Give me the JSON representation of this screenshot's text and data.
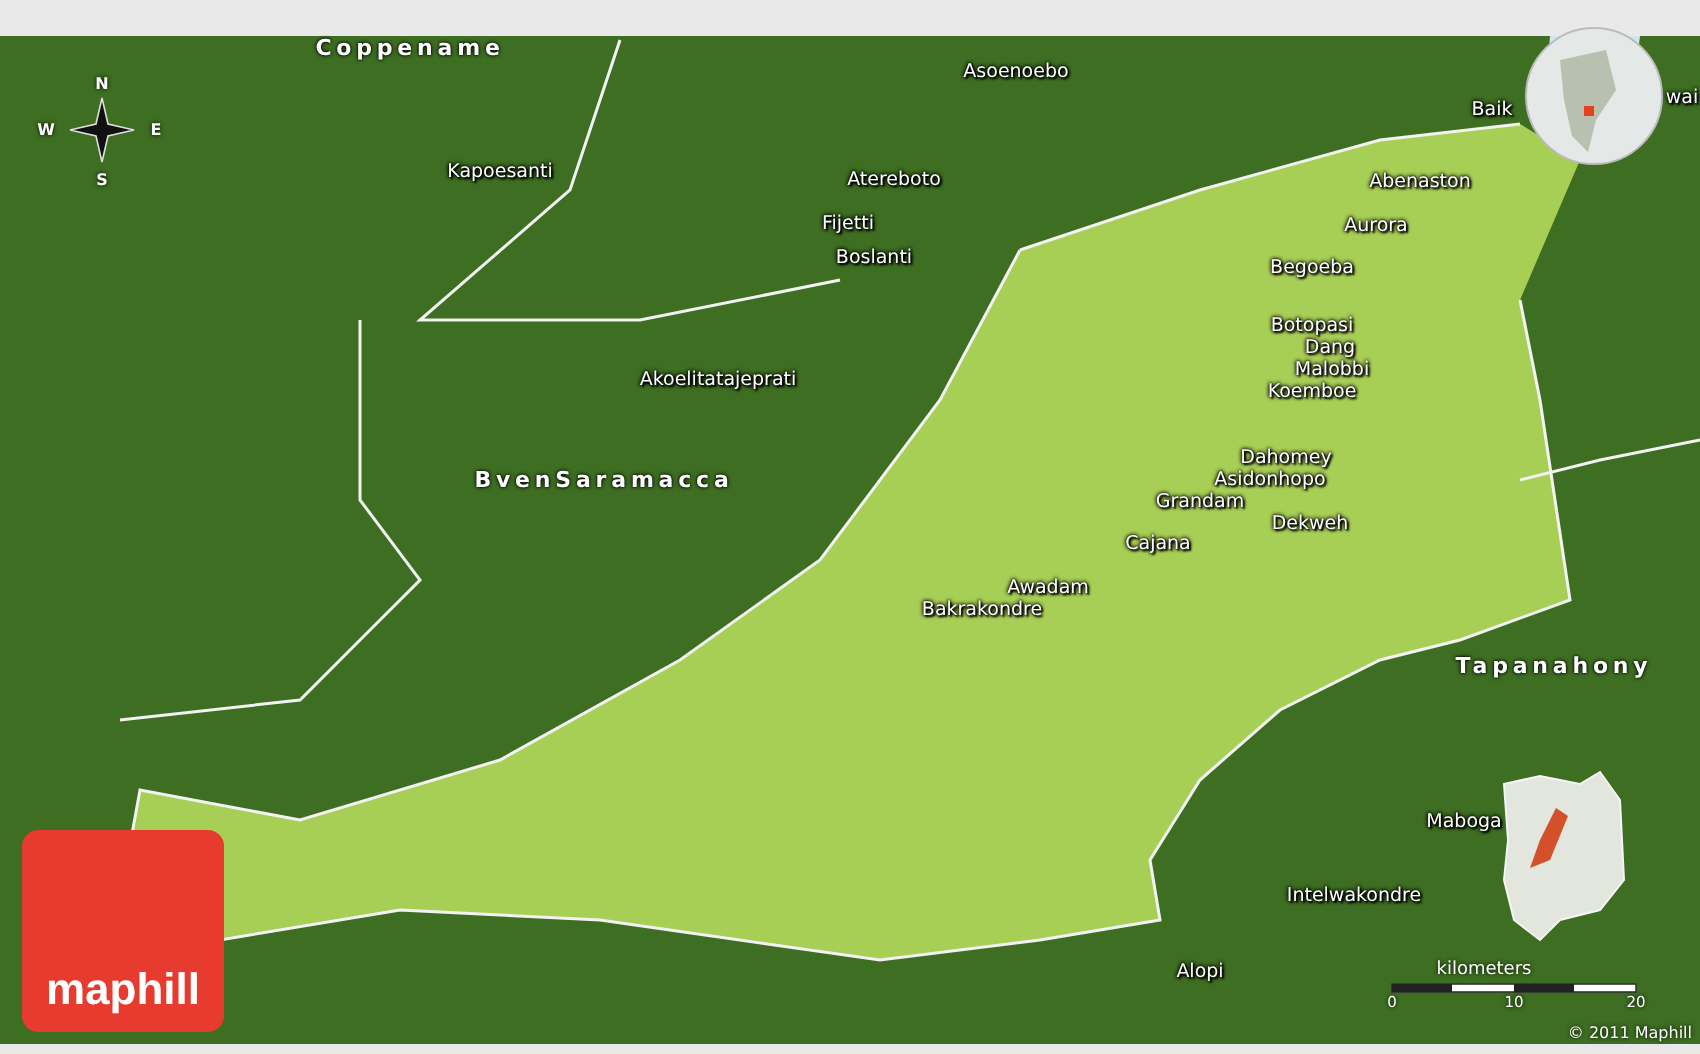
{
  "map": {
    "labels": [
      {
        "text": "Coppename",
        "kind": "region"
      },
      {
        "text": "Kapoesanti",
        "kind": "place"
      },
      {
        "text": "Asoenoebo",
        "kind": "place"
      },
      {
        "text": "Atereboto",
        "kind": "place"
      },
      {
        "text": "Fijetti",
        "kind": "place"
      },
      {
        "text": "Boslanti",
        "kind": "place"
      },
      {
        "text": "Akoelitatajeprati",
        "kind": "place"
      },
      {
        "text": "BvenSaramacca",
        "kind": "region"
      },
      {
        "text": "Baik",
        "kind": "place"
      },
      {
        "text": "wai",
        "kind": "place"
      },
      {
        "text": "Abenaston",
        "kind": "place"
      },
      {
        "text": "Aurora",
        "kind": "place"
      },
      {
        "text": "Begoeba",
        "kind": "place"
      },
      {
        "text": "Botopasi",
        "kind": "place"
      },
      {
        "text": "Dang",
        "kind": "place"
      },
      {
        "text": "Malobbi",
        "kind": "place"
      },
      {
        "text": "Koemboe",
        "kind": "place"
      },
      {
        "text": "Dahomey",
        "kind": "place"
      },
      {
        "text": "Asidonhopo",
        "kind": "place"
      },
      {
        "text": "Grandam",
        "kind": "place"
      },
      {
        "text": "Dekweh",
        "kind": "place"
      },
      {
        "text": "Cajana",
        "kind": "place"
      },
      {
        "text": "Awadam",
        "kind": "place"
      },
      {
        "text": "Bakrakondre",
        "kind": "place"
      },
      {
        "text": "Tapanahony",
        "kind": "region"
      },
      {
        "text": "Maboga",
        "kind": "place"
      },
      {
        "text": "Intelwakondre",
        "kind": "place"
      },
      {
        "text": "Alopi",
        "kind": "place"
      }
    ],
    "compass": {
      "north": "N",
      "east": "E",
      "south": "S",
      "west": "W"
    },
    "scale": {
      "unit": "kilometers",
      "ticks": [
        "0",
        "10",
        "20"
      ]
    },
    "copyright": "© 2011 Maphill",
    "logo": "maphill"
  }
}
